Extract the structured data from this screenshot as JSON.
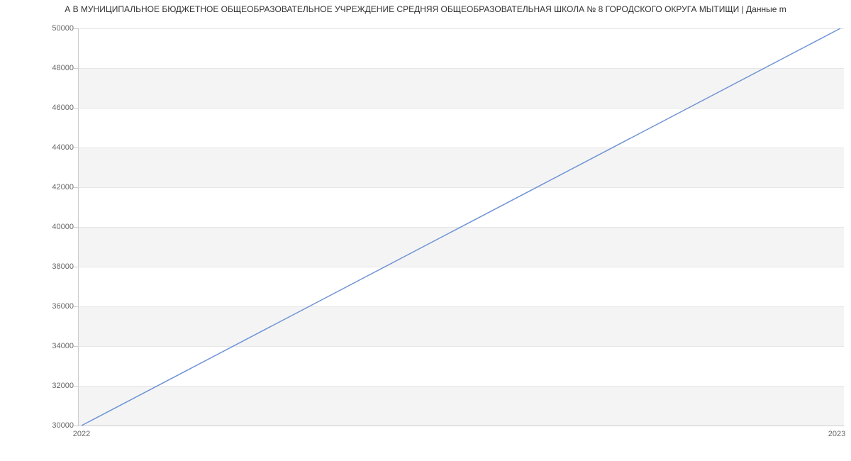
{
  "chart_data": {
    "type": "line",
    "title": "А В МУНИЦИПАЛЬНОЕ БЮДЖЕТНОЕ ОБЩЕОБРАЗОВАТЕЛЬНОЕ УЧРЕЖДЕНИЕ СРЕДНЯЯ ОБЩЕОБРАЗОВАТЕЛЬНАЯ ШКОЛА № 8 ГОРОДСКОГО ОКРУГА МЫТИЩИ | Данные m",
    "x": [
      "2022",
      "2023"
    ],
    "series": [
      {
        "name": "series1",
        "values": [
          30000,
          50000
        ],
        "color": "#6f94d6"
      }
    ],
    "xlabel": "",
    "ylabel": "",
    "ylim": [
      30000,
      50000
    ],
    "yticks": [
      30000,
      32000,
      34000,
      36000,
      38000,
      40000,
      42000,
      44000,
      46000,
      48000,
      50000
    ],
    "xticks": [
      "2022",
      "2023"
    ],
    "grid": true
  }
}
